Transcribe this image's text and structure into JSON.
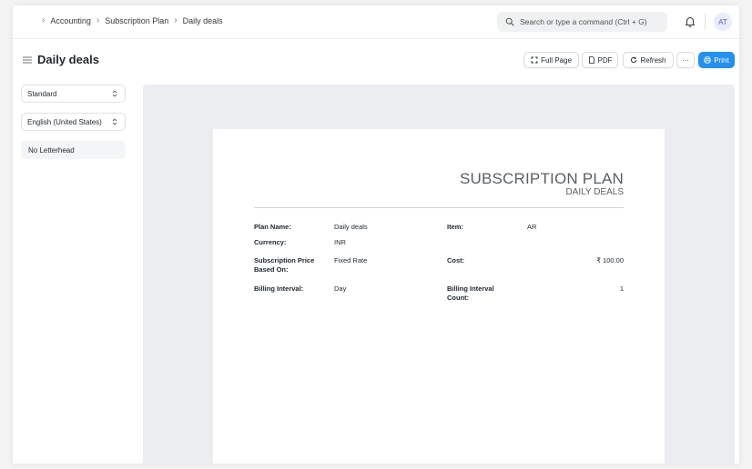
{
  "breadcrumbs": [
    "Accounting",
    "Subscription Plan",
    "Daily deals"
  ],
  "search": {
    "placeholder": "Search or type a command (Ctrl + G)"
  },
  "user": {
    "initials": "AT"
  },
  "page": {
    "title": "Daily deals"
  },
  "toolbar": {
    "full_page": "Full Page",
    "pdf": "PDF",
    "refresh": "Refresh",
    "more": "···",
    "print": "Print"
  },
  "sidebar": {
    "print_format": "Standard",
    "language": "English (United States)",
    "letterhead": "No Letterhead"
  },
  "document": {
    "title": "SUBSCRIPTION PLAN",
    "subtitle": "DAILY DEALS",
    "fields": {
      "plan_name_label": "Plan Name:",
      "plan_name_value": "Daily deals",
      "item_label": "Item:",
      "item_value": "AR",
      "currency_label": "Currency:",
      "currency_value": "INR",
      "price_based_label": "Subscription Price Based On:",
      "price_based_value": "Fixed Rate",
      "cost_label": "Cost:",
      "cost_value": "₹ 100.00",
      "billing_interval_label": "Billing Interval:",
      "billing_interval_value": "Day",
      "billing_count_label": "Billing Interval Count:",
      "billing_count_value": "1"
    }
  },
  "colors": {
    "primary": "#2490ef",
    "preview_bg": "#ebedf0"
  }
}
